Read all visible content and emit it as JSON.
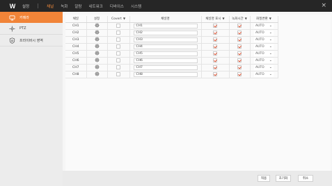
{
  "topbar": {
    "logo": "W",
    "title": "설정",
    "menu": [
      "채널",
      "녹화",
      "알람",
      "네트워크",
      "디바이스",
      "시스템"
    ],
    "active_index": 0,
    "close": "×"
  },
  "sidebar": {
    "items": [
      {
        "label": "카메라",
        "icon": "camera-icon",
        "active": true
      },
      {
        "label": "PTZ",
        "icon": "ptz-icon",
        "active": false
      },
      {
        "label": "프라이버시 영역",
        "icon": "privacy-icon",
        "active": false
      }
    ]
  },
  "table": {
    "headers": {
      "channel": "채널",
      "settings": "설정",
      "covert": "Covert",
      "name": "채널명",
      "show_name": "채널명 표시",
      "record_time": "녹화시간",
      "quality": "화질변환"
    },
    "rows": [
      {
        "channel": "CH1",
        "covert": false,
        "name": "CH1",
        "show_name": true,
        "record_time": true,
        "quality": "AUTO"
      },
      {
        "channel": "CH2",
        "covert": false,
        "name": "CH2",
        "show_name": true,
        "record_time": true,
        "quality": "AUTO"
      },
      {
        "channel": "CH3",
        "covert": false,
        "name": "CH3",
        "show_name": true,
        "record_time": true,
        "quality": "AUTO"
      },
      {
        "channel": "CH4",
        "covert": false,
        "name": "CH4",
        "show_name": true,
        "record_time": true,
        "quality": "AUTO"
      },
      {
        "channel": "CH5",
        "covert": false,
        "name": "CH5",
        "show_name": true,
        "record_time": true,
        "quality": "AUTO"
      },
      {
        "channel": "CH6",
        "covert": false,
        "name": "CH6",
        "show_name": true,
        "record_time": true,
        "quality": "AUTO"
      },
      {
        "channel": "CH7",
        "covert": false,
        "name": "CH7",
        "show_name": true,
        "record_time": true,
        "quality": "AUTO"
      },
      {
        "channel": "CH8",
        "covert": false,
        "name": "CH8",
        "show_name": true,
        "record_time": true,
        "quality": "AUTO"
      }
    ]
  },
  "footer": {
    "apply": "적용",
    "reset": "초기화",
    "cancel": "취소"
  },
  "colors": {
    "accent": "#f18438",
    "check": "#e45a3a",
    "topbar": "#262626",
    "sidebar": "#ececec"
  }
}
